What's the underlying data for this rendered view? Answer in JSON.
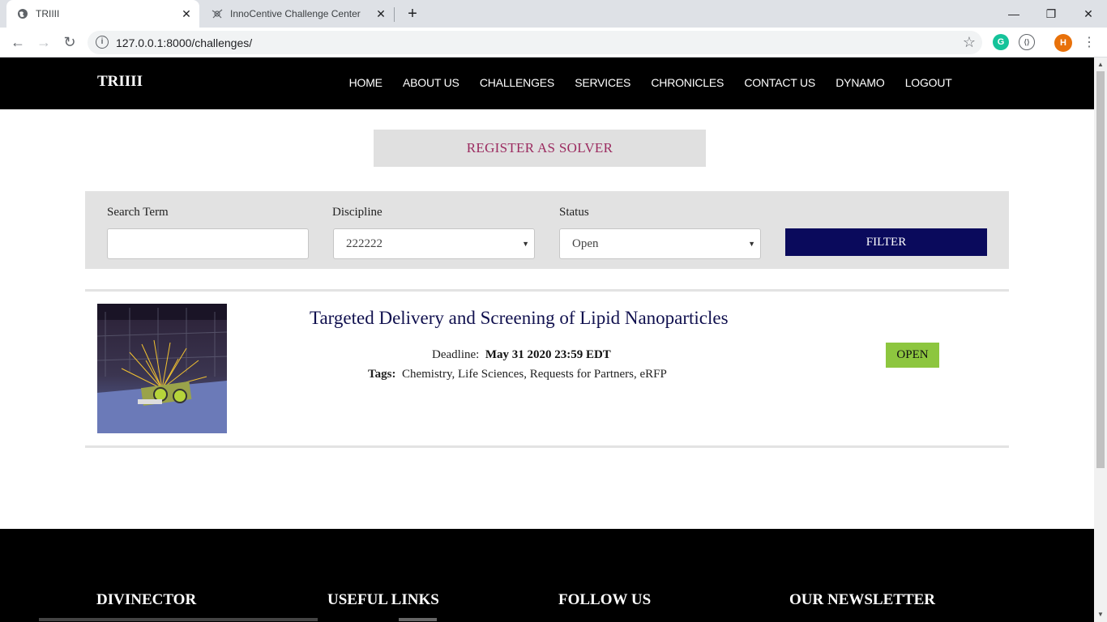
{
  "browser": {
    "tabs": [
      {
        "title": "TRIIII",
        "active": true
      },
      {
        "title": "InnoCentive Challenge Center",
        "active": false
      }
    ],
    "url": "127.0.0.1:8000/challenges/",
    "profile_initial": "H"
  },
  "header": {
    "brand": "TRIIII",
    "nav": [
      "HOME",
      "ABOUT US",
      "CHALLENGES",
      "SERVICES",
      "CHRONICLES",
      "CONTACT US",
      "DYNAMO",
      "LOGOUT"
    ]
  },
  "register": {
    "label": "REGISTER AS SOLVER"
  },
  "filter": {
    "search_label": "Search Term",
    "search_value": "",
    "discipline_label": "Discipline",
    "discipline_value": "222222",
    "status_label": "Status",
    "status_value": "Open",
    "button_label": "FILTER"
  },
  "challenges": [
    {
      "title": "Targeted Delivery and Screening of Lipid Nanoparticles",
      "deadline_label": "Deadline:",
      "deadline_value": "May 31 2020 23:59 EDT",
      "tags_label": "Tags:",
      "tags_value": "Chemistry, Life Sciences, Requests for Partners, eRFP",
      "status": "OPEN"
    }
  ],
  "footer": {
    "columns": [
      "DIVINECTOR",
      "USEFUL LINKS",
      "FOLLOW US",
      "OUR NEWSLETTER"
    ]
  },
  "colors": {
    "header_bg": "#000000",
    "register_text": "#9b2a5f",
    "filter_button": "#0a0a5c",
    "title_text": "#10104e",
    "open_badge": "#8dc63f"
  }
}
